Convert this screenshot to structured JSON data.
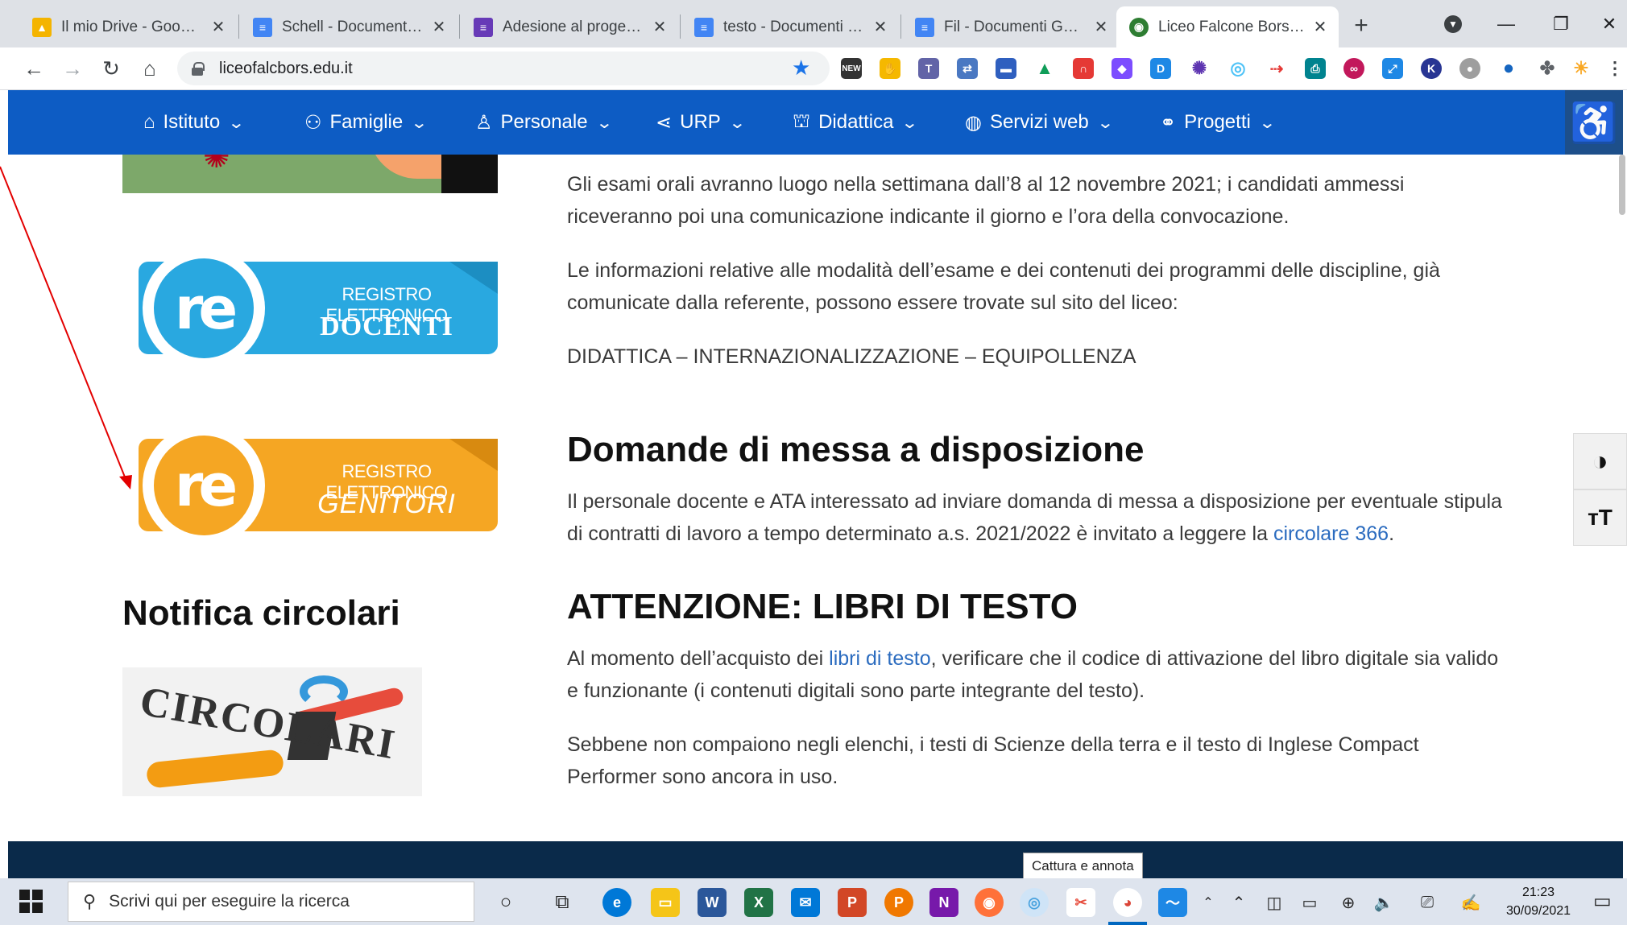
{
  "browser": {
    "tabs": [
      {
        "title": "Il mio Drive - Google Drive",
        "icon": "google-drive-icon",
        "color": "#f4b400"
      },
      {
        "title": "Schell - Documenti Google",
        "icon": "google-docs-icon",
        "color": "#4285f4"
      },
      {
        "title": "Adesione al progetto Erasmus",
        "icon": "google-forms-icon",
        "color": "#673ab7"
      },
      {
        "title": "testo - Documenti Google",
        "icon": "google-docs-icon",
        "color": "#4285f4"
      },
      {
        "title": "Fil - Documenti Google",
        "icon": "google-docs-icon",
        "color": "#4285f4"
      },
      {
        "title": "Liceo Falcone Borsellino",
        "icon": "site-favicon",
        "color": "#2e7d32"
      }
    ],
    "active_tab": 5,
    "new_tab": "+",
    "url": "liceofalcbors.edu.it"
  },
  "site_nav": {
    "items": [
      {
        "label": "Istituto",
        "icon": "⌂"
      },
      {
        "label": "Famiglie",
        "icon": "⚇"
      },
      {
        "label": "Personale",
        "icon": "♙"
      },
      {
        "label": "URP",
        "icon": "⋖"
      },
      {
        "label": "Didattica",
        "icon": "⛫"
      },
      {
        "label": "Servizi web",
        "icon": "◍"
      },
      {
        "label": "Progetti",
        "icon": "⚭"
      }
    ],
    "chevron": "⌄",
    "accessibility_icon": "♿",
    "color": "#0d5cc4"
  },
  "sidebar": {
    "badge_docenti": {
      "line1": "REGISTRO ELETTRONICO",
      "line2": "DOCENTI",
      "color": "#29a8e0"
    },
    "badge_genitori": {
      "line1": "REGISTRO ELETTRONICO",
      "line2": "GENITORI",
      "color": "#f5a623"
    },
    "notifica_title": "Notifica circolari",
    "circolari_image_text": "CIRCOLARI"
  },
  "main": {
    "p1": "Gli esami orali avranno luogo nella settimana dall’8 al 12 novembre 2021; i candidati ammessi riceveranno poi una comunicazione indicante il giorno e l’ora della convocazione.",
    "p2": "Le informazioni relative alle modalità dell’esame e dei contenuti dei programmi delle discipline, già comunicate dalla referente, possono essere trovate sul sito del liceo:",
    "p3": "DIDATTICA – INTERNAZIONALIZZAZIONE  – EQUIPOLLENZA",
    "h_domande": "Domande di messa a disposizione",
    "p4_pre": "Il personale docente e ATA interessato ad inviare domanda di messa a disposizione per eventuale stipula di contratti di lavoro a tempo determinato a.s. 2021/2022 è invitato a leggere la ",
    "p4_link": "circolare 366",
    "p4_post": ".",
    "h_libri": "ATTENZIONE: LIBRI DI TESTO",
    "p5_pre": "Al momento dell’acquisto dei ",
    "p5_link": "libri di testo",
    "p5_post": ", verificare che il codice di attivazione del libro digitale sia valido e funzionante (i contenuti digitali sono parte integrante del testo).",
    "p6": "Sebbene non compaiono negli elenchi, i testi di Scienze della terra e il testo di Inglese Compact Performer sono ancora in uso."
  },
  "side_tools": {
    "contrast": "◑",
    "text_size": "ᴛT"
  },
  "tooltip": "Cattura e annota",
  "taskbar": {
    "search_placeholder": "Scrivi qui per eseguire la ricerca",
    "time": "21:23",
    "date": "30/09/2021"
  }
}
